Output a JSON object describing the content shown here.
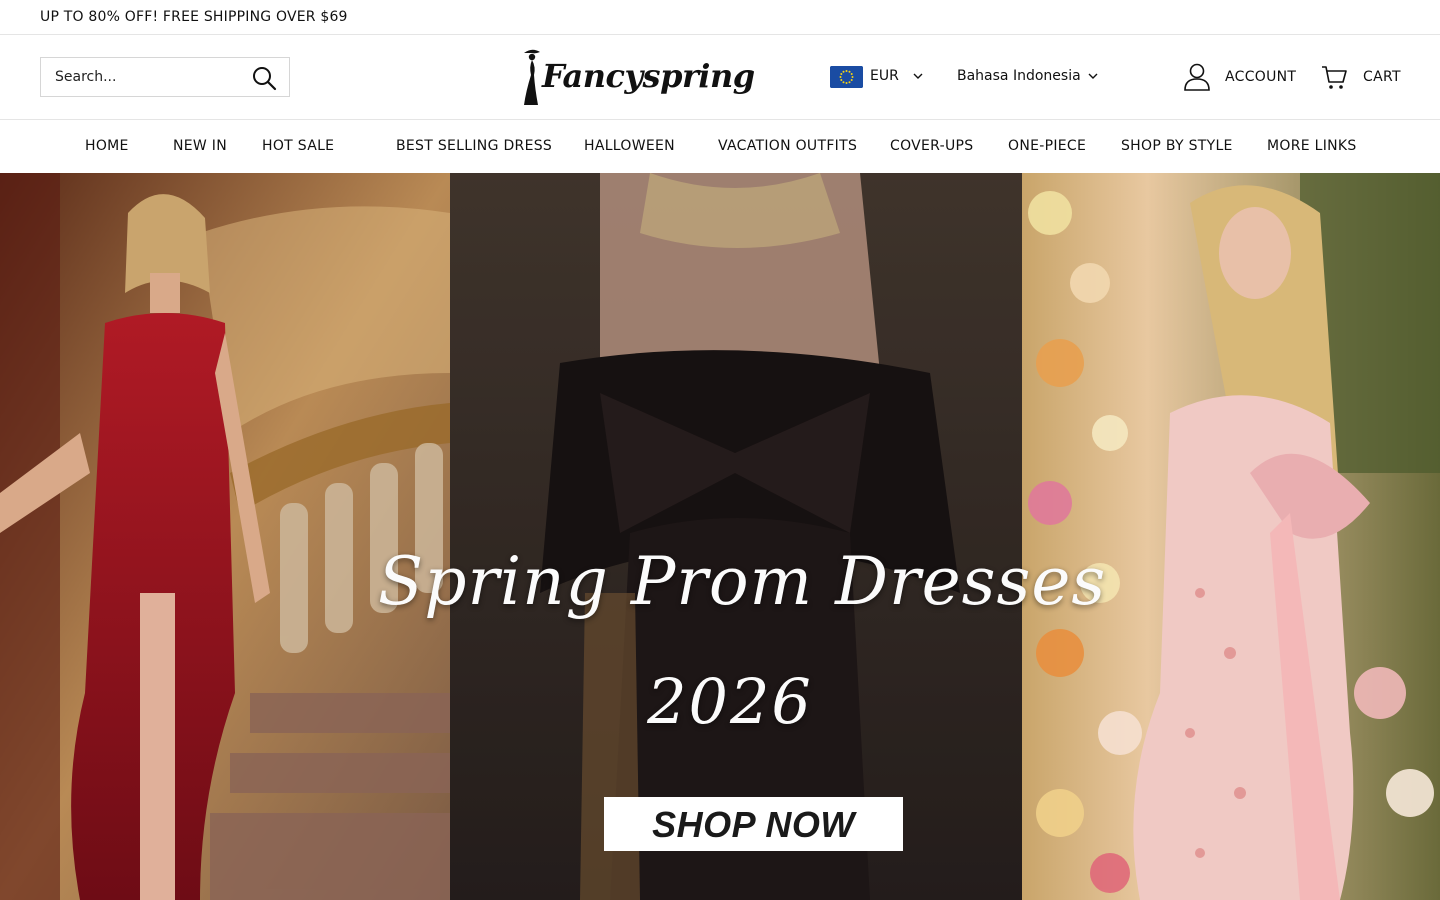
{
  "announcement": {
    "text": "UP TO 80% OFF! FREE SHIPPING OVER $69"
  },
  "header": {
    "search": {
      "placeholder": "Search..."
    },
    "logo": {
      "text": "Fancyspring"
    },
    "currency": {
      "code": "EUR",
      "flag": "eu-flag-icon"
    },
    "language": {
      "name": "Bahasa Indonesia"
    },
    "account_label": "ACCOUNT",
    "cart_label": "CART"
  },
  "nav": {
    "items": [
      {
        "label": "HOME"
      },
      {
        "label": "NEW IN"
      },
      {
        "label": "HOT SALE"
      },
      {
        "label": "BEST SELLING DRESS"
      },
      {
        "label": "HALLOWEEN"
      },
      {
        "label": "VACATION OUTFITS"
      },
      {
        "label": "COVER-UPS"
      },
      {
        "label": "ONE-PIECE"
      },
      {
        "label": "SHOP BY STYLE"
      },
      {
        "label": "MORE LINKS"
      }
    ]
  },
  "hero": {
    "title_line1": "Spring Prom Dresses",
    "title_line2": "2026",
    "cta_label": "SHOP NOW"
  },
  "colors": {
    "text": "#111111",
    "border": "#e5e5e5",
    "flag_blue": "#1a4ca3",
    "dress_red": "#8e0f1c",
    "dress_black": "#1b1414",
    "dress_pink": "#f0c9c4"
  }
}
